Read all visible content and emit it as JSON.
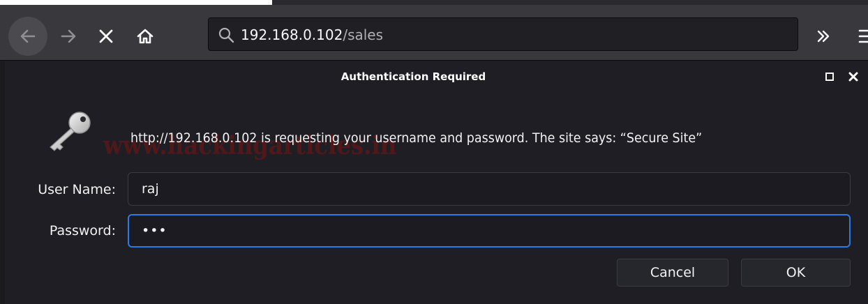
{
  "browser": {
    "url_host": "192.168.0.102",
    "url_path": "/sales",
    "icons": {
      "back": "back-arrow-icon",
      "forward": "forward-arrow-icon",
      "stop": "stop-x-icon",
      "home": "home-icon",
      "search": "search-icon",
      "overflow": "chevron-double-right-icon",
      "menu": "hamburger-menu-icon"
    }
  },
  "dialog": {
    "title": "Authentication Required",
    "message": "http://192.168.0.102 is requesting your username and password. The site says: “Secure Site”",
    "watermark": "www.hackingarticles.in",
    "username_label": "User Name:",
    "username_value": "raj",
    "password_label": "Password:",
    "password_value": "•••",
    "cancel_label": "Cancel",
    "ok_label": "OK",
    "icons": {
      "key": "key-icon",
      "maximize": "maximize-icon",
      "close": "close-icon"
    },
    "colors": {
      "focus_border": "#2c7be5",
      "watermark": "#7a1412"
    }
  }
}
